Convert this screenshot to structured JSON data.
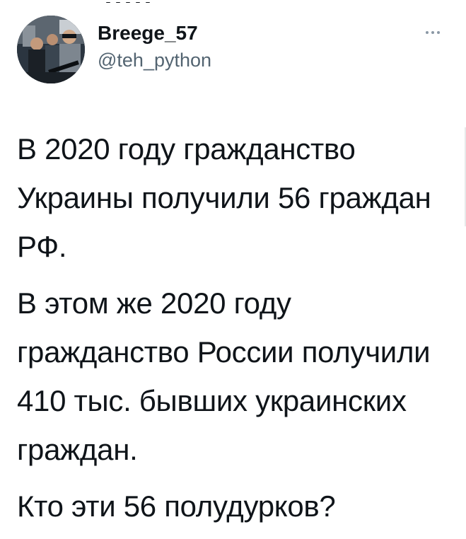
{
  "tweet": {
    "author": {
      "display_name": "Вreege_57",
      "username": "@teh_python",
      "avatar": "avatar-photo"
    },
    "more_icon": "more-horizontal-icon",
    "paragraphs": [
      "В 2020 году гражданство Украины получили 56 граждан РФ.",
      "В этом же 2020 году гражданство России получили 410 тыс. бывших украинских граждан.",
      "Кто эти 56 полудурков?"
    ]
  },
  "colors": {
    "text": "#0f1419",
    "secondary": "#536471",
    "icon": "#8b98a5",
    "background": "#ffffff"
  }
}
